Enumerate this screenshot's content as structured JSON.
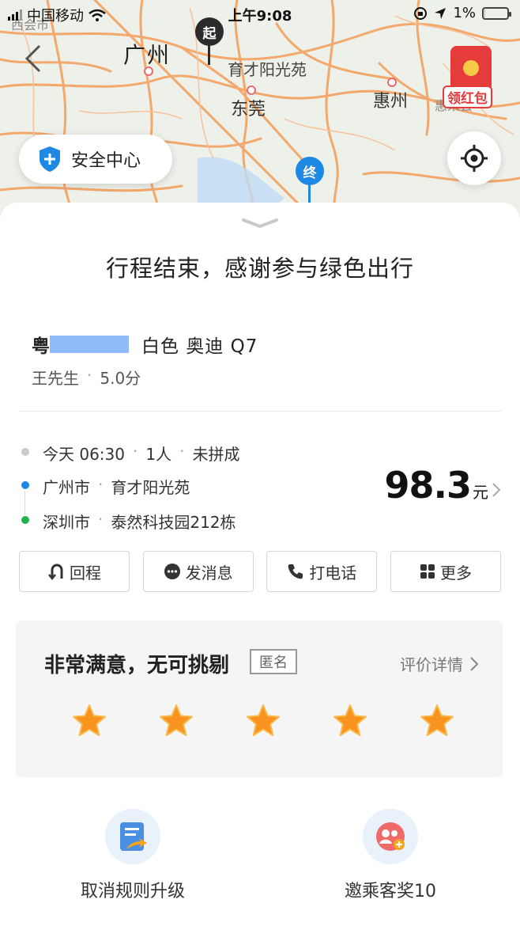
{
  "status_bar": {
    "carrier": "中国移动",
    "time": "上午9:08",
    "battery": "1%",
    "battery_level": 0.01
  },
  "map": {
    "labels": [
      "西会市",
      "广州",
      "育才阳光苑",
      "东莞",
      "惠州",
      "惠来会"
    ],
    "start_pin": "起",
    "end_pin": "终",
    "red_packet": "领红包",
    "safety_center": "安全中心"
  },
  "sheet": {
    "title": "行程结束，感谢参与绿色出行",
    "car": {
      "plate_prefix": "粤",
      "description": "白色 奥迪 Q7"
    },
    "driver": {
      "name": "王先生",
      "rating": "5.0分"
    },
    "trip": {
      "meta": [
        "今天 06:30",
        "1人",
        "未拼成"
      ],
      "from": [
        "广州市",
        "育才阳光苑"
      ],
      "to": [
        "深圳市",
        "泰然科技园212栋"
      ],
      "price": "98.3",
      "currency": "元"
    },
    "actions": [
      {
        "label": "回程",
        "icon": "return-trip-icon"
      },
      {
        "label": "发消息",
        "icon": "message-icon"
      },
      {
        "label": "打电话",
        "icon": "phone-icon"
      },
      {
        "label": "更多",
        "icon": "grid-more-icon"
      }
    ],
    "rating": {
      "title": "非常满意，无可挑剔",
      "anonymous": "匿名",
      "detail": "评价详情",
      "stars": 5,
      "max_stars": 5,
      "star_color": "#f7931e"
    },
    "bottom": [
      {
        "label": "取消规则升级",
        "icon": "document-upgrade-icon"
      },
      {
        "label": "邀乘客奖10",
        "icon": "invite-passenger-icon"
      }
    ]
  },
  "colors": {
    "accent_blue": "#1e88e5",
    "green": "#22b24c",
    "price": "#111111"
  }
}
